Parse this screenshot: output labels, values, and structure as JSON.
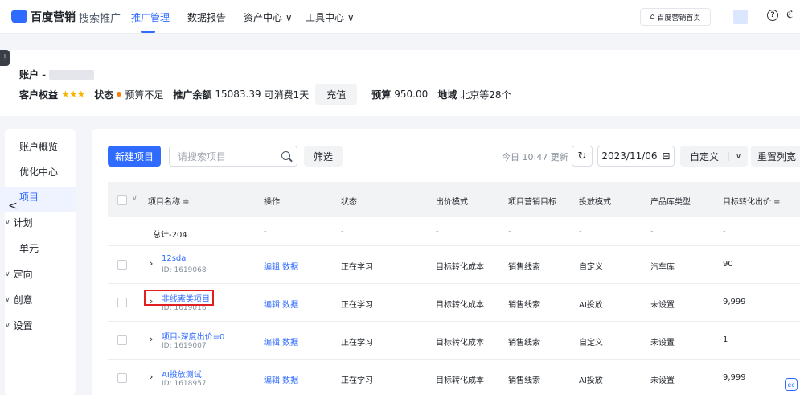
{
  "topbar": {
    "logo_text": "百度营销",
    "logo_sub": "搜索推广",
    "nav": [
      {
        "label": "推广管理",
        "active": true
      },
      {
        "label": "数据报告"
      },
      {
        "label": "资产中心 ∨"
      },
      {
        "label": "工具中心 ∨"
      }
    ],
    "home_label": "百度营销首页",
    "help_symbol": "?",
    "cut_symbol": "ℭ"
  },
  "account": {
    "side_tab": "⋮",
    "title": "账户 -",
    "rights_label": "客户权益",
    "stars": "★★★",
    "status_label": "状态",
    "status_value": "预算不足",
    "balance_label": "推广余额",
    "balance_value": "15083.39",
    "consumable": "可消费1天",
    "recharge_label": "充值",
    "budget_label": "预算",
    "budget_value": "950.00",
    "region_label": "地域",
    "region_value": "北京等28个"
  },
  "sidebar": {
    "items": [
      {
        "label": "账户概览"
      },
      {
        "label": "优化中心"
      },
      {
        "label": "项目",
        "active": true
      },
      {
        "label": "计划",
        "group": true
      },
      {
        "label": "单元"
      },
      {
        "label": "定向",
        "group": true
      },
      {
        "label": "创意",
        "group": true
      },
      {
        "label": "设置",
        "group": true
      }
    ],
    "back_symbol": "<"
  },
  "toolbar": {
    "new_project": "新建项目",
    "search_placeholder": "请搜索项目",
    "filter": "筛选",
    "update_text": "今日 10:47 更新",
    "refresh_symbol": "↻",
    "date": "2023/11/06",
    "date_icon": "⊟",
    "custom": "自定义",
    "custom_arrow": "∨",
    "reset": "重置列宽"
  },
  "table": {
    "headers": [
      "项目名称 ≑",
      "操作",
      "状态",
      "出价模式",
      "项目营销目标",
      "投放模式",
      "产品库类型",
      "目标转化出价 ≑"
    ],
    "total_row": [
      "总计-204",
      "-",
      "-",
      "-",
      "-",
      "-",
      "-",
      "-"
    ],
    "rows": [
      {
        "name": "12sda",
        "id": "ID: 1619068",
        "ops": "编辑 数据",
        "status": "正在学习",
        "bid": "目标转化成本",
        "goal": "销售线索",
        "mode": "自定义",
        "lib": "汽车库",
        "price": "90"
      },
      {
        "name": "非线索类项目",
        "id": "ID: 1619016",
        "ops": "编辑 数据",
        "status": "正在学习",
        "bid": "目标转化成本",
        "goal": "销售线索",
        "mode": "AI投放",
        "lib": "未设置",
        "price": "9,999"
      },
      {
        "name": "项目-深度出价=0",
        "id": "ID: 1619007",
        "ops": "编辑 数据",
        "status": "正在学习",
        "bid": "目标转化成本",
        "goal": "销售线索",
        "mode": "自定义",
        "lib": "未设置",
        "price": "1"
      },
      {
        "name": "AI投放测试",
        "id": "ID: 1618957",
        "ops": "编辑 数据",
        "status": "正在学习",
        "bid": "目标转化成本",
        "goal": "销售线索",
        "mode": "AI投放",
        "lib": "未设置",
        "price": "9,999"
      }
    ],
    "expand_symbol": "›",
    "corner_text": "ec"
  }
}
